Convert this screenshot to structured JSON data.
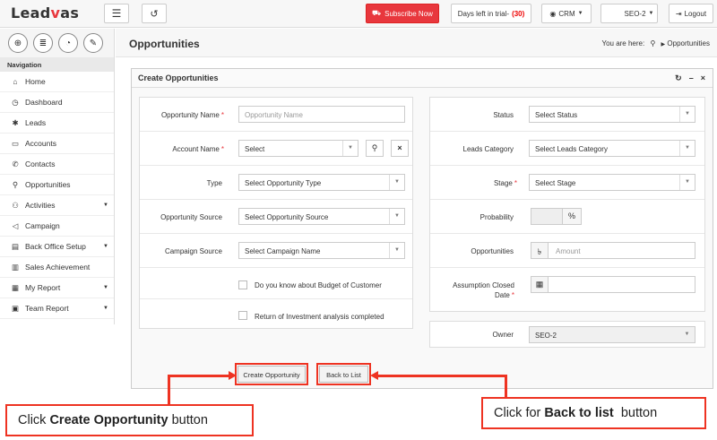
{
  "brand": {
    "name": "Leadvas"
  },
  "topbar": {
    "menu_icon": "hamburger-icon",
    "history_icon": "history-icon",
    "subscribe": "Subscribe Now",
    "trial_label": "Days left in trial-",
    "trial_days": "(30)",
    "crm": "CRM",
    "user": "SEO-2",
    "logout": "Logout"
  },
  "iconrow": [
    "lifebuoy-icon",
    "database-icon",
    "pie-chart-icon",
    "pencil-icon"
  ],
  "sidebar": {
    "heading": "Navigation",
    "items": [
      {
        "label": "Home",
        "icon": "home-icon",
        "glyph": "⌂",
        "caret": false
      },
      {
        "label": "Dashboard",
        "icon": "dashboard-icon",
        "glyph": "◷",
        "caret": false
      },
      {
        "label": "Leads",
        "icon": "leads-icon",
        "glyph": "✱",
        "caret": false
      },
      {
        "label": "Accounts",
        "icon": "accounts-icon",
        "glyph": "▭",
        "caret": false
      },
      {
        "label": "Contacts",
        "icon": "phone-icon",
        "glyph": "✆",
        "caret": false
      },
      {
        "label": "Opportunities",
        "icon": "opportunities-icon",
        "glyph": "⚲",
        "caret": false
      },
      {
        "label": "Activities",
        "icon": "activities-icon",
        "glyph": "⚇",
        "caret": true
      },
      {
        "label": "Campaign",
        "icon": "campaign-icon",
        "glyph": "◁",
        "caret": false
      },
      {
        "label": "Back Office Setup",
        "icon": "setup-icon",
        "glyph": "▤",
        "caret": true
      },
      {
        "label": "Sales Achievement",
        "icon": "achievement-icon",
        "glyph": "▥",
        "caret": false
      },
      {
        "label": "My Report",
        "icon": "report-icon",
        "glyph": "▦",
        "caret": true
      },
      {
        "label": "Team Report",
        "icon": "team-report-icon",
        "glyph": "▣",
        "caret": true
      }
    ]
  },
  "page": {
    "title": "Opportunities",
    "crumb_prefix": "You are here:",
    "crumb": "Opportunities"
  },
  "panel": {
    "title": "Create Opportunities"
  },
  "left": {
    "opp_name": {
      "label": "Opportunity Name",
      "placeholder": "Opportunity Name"
    },
    "account": {
      "label": "Account Name",
      "value": "Select"
    },
    "type": {
      "label": "Type",
      "value": "Select Opportunity Type"
    },
    "source": {
      "label": "Opportunity Source",
      "value": "Select Opportunity Source"
    },
    "campaign": {
      "label": "Campaign Source",
      "value": "Select Campaign Name"
    },
    "chk1": "Do you know about Budget of Customer",
    "chk2": "Return of Investment analysis completed"
  },
  "right": {
    "status": {
      "label": "Status",
      "value": "Select Status"
    },
    "leads_cat": {
      "label": "Leads Category",
      "value": "Select Leads Category"
    },
    "stage": {
      "label": "Stage",
      "value": "Select Stage"
    },
    "probability": {
      "label": "Probability",
      "unit": "%"
    },
    "opportunities": {
      "label": "Opportunities",
      "placeholder": "Amount",
      "currency": "৳"
    },
    "closed_date": {
      "label1": "Assumption Closed",
      "label2": "Date"
    },
    "owner": {
      "label": "Owner",
      "value": "SEO-2"
    }
  },
  "buttons": {
    "create": "Create Opportunity",
    "back": "Back to List"
  },
  "callouts": {
    "left_pre": "Click ",
    "left_bold": "Create Opportunity",
    "left_post": " button",
    "right_pre": "Click for ",
    "right_bold": "Back to list",
    "right_post": "  button"
  },
  "colors": {
    "accent": "#e8373d",
    "annotation": "#e32222"
  }
}
